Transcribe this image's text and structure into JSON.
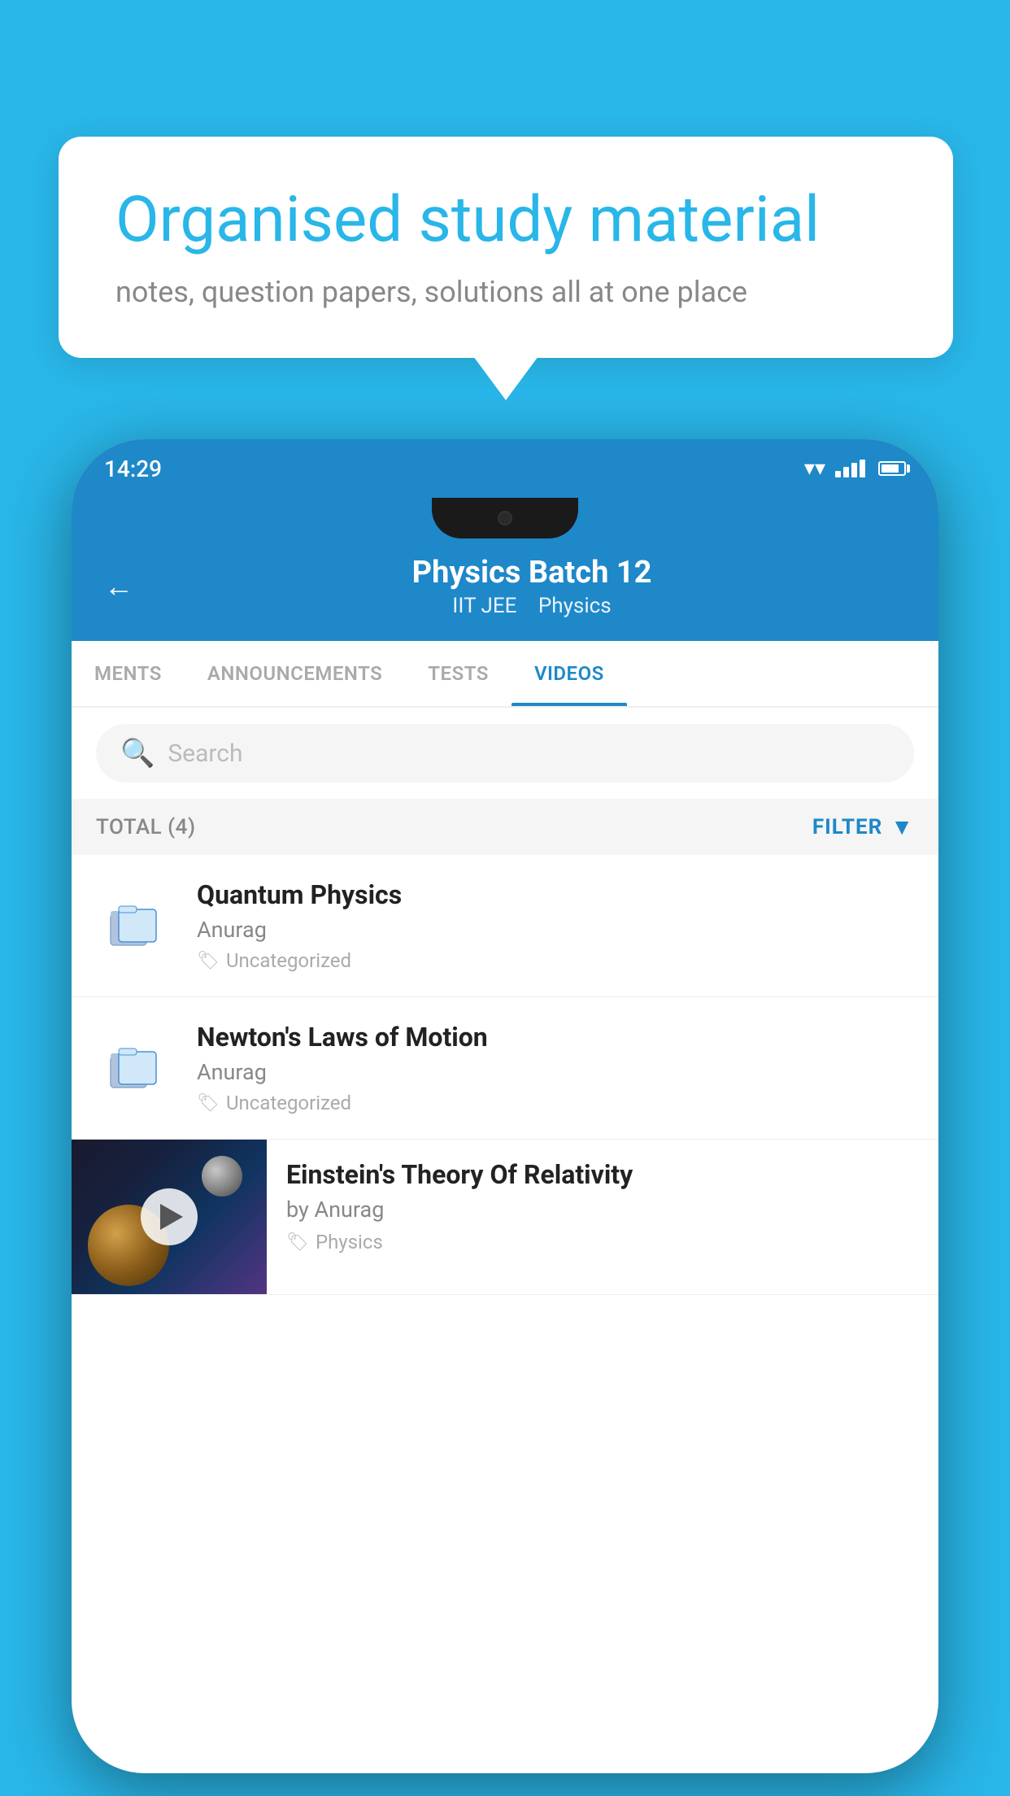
{
  "background": {
    "color": "#29b6e8"
  },
  "speechBubble": {
    "title": "Organised study material",
    "subtitle": "notes, question papers, solutions all at one place"
  },
  "phone": {
    "statusBar": {
      "time": "14:29",
      "wifi": true,
      "signal": true,
      "battery": true
    },
    "header": {
      "backLabel": "←",
      "title": "Physics Batch 12",
      "subtitleParts": [
        "IIT JEE",
        "Physics"
      ]
    },
    "tabs": [
      {
        "label": "MENTS",
        "active": false
      },
      {
        "label": "ANNOUNCEMENTS",
        "active": false
      },
      {
        "label": "TESTS",
        "active": false
      },
      {
        "label": "VIDEOS",
        "active": true
      }
    ],
    "search": {
      "placeholder": "Search"
    },
    "filterBar": {
      "totalLabel": "TOTAL (4)",
      "filterLabel": "FILTER"
    },
    "videos": [
      {
        "title": "Quantum Physics",
        "author": "Anurag",
        "tag": "Uncategorized",
        "type": "folder",
        "hasThumb": false
      },
      {
        "title": "Newton's Laws of Motion",
        "author": "Anurag",
        "tag": "Uncategorized",
        "type": "folder",
        "hasThumb": false
      },
      {
        "title": "Einstein's Theory Of Relativity",
        "author": "by Anurag",
        "tag": "Physics",
        "type": "video",
        "hasThumb": true
      }
    ]
  }
}
